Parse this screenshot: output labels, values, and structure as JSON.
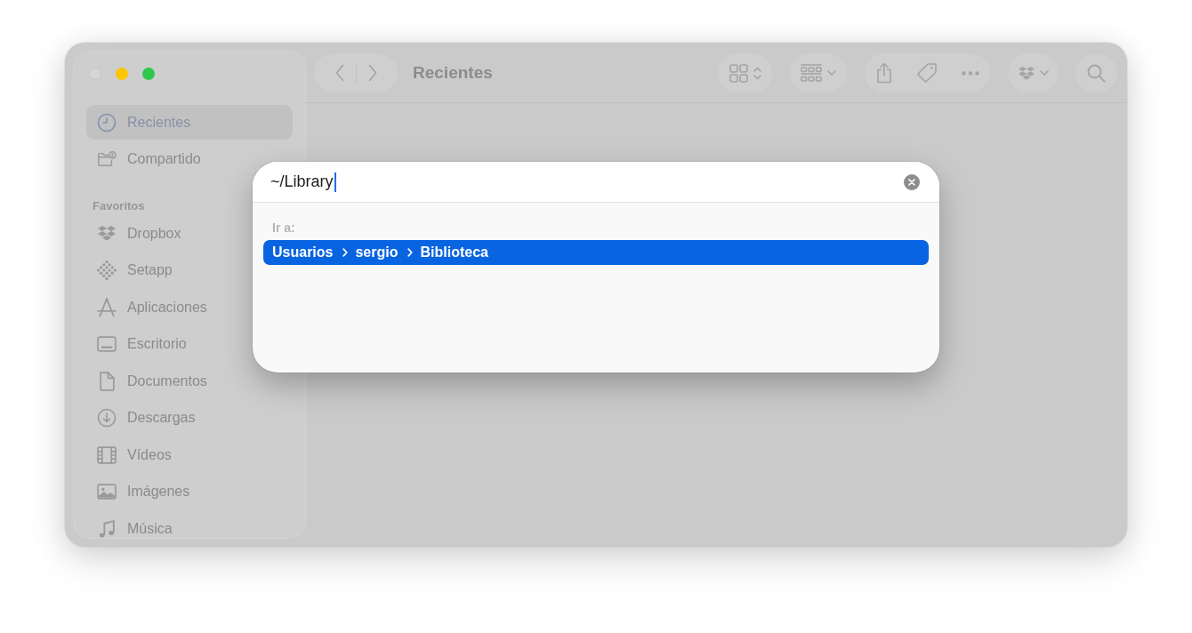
{
  "window": {
    "traffic_lights": [
      {
        "kind": "close",
        "disabled": true
      },
      {
        "kind": "minimize",
        "disabled": false
      },
      {
        "kind": "zoom",
        "disabled": false
      }
    ],
    "title": "Recientes"
  },
  "sidebar": {
    "items": [
      {
        "label": "Recientes",
        "kind": "recents",
        "selected": true
      },
      {
        "label": "Compartido",
        "kind": "shared",
        "selected": false
      }
    ],
    "sections": [
      {
        "title": "Favoritos",
        "items": [
          {
            "label": "Dropbox",
            "kind": "dropbox",
            "selected": false
          },
          {
            "label": "Setapp",
            "kind": "setapp",
            "selected": false
          },
          {
            "label": "Aplicaciones",
            "kind": "applications",
            "selected": false
          },
          {
            "label": "Escritorio",
            "kind": "desktop",
            "selected": false
          },
          {
            "label": "Documentos",
            "kind": "documents",
            "selected": false
          },
          {
            "label": "Descargas",
            "kind": "downloads",
            "selected": false
          },
          {
            "label": "Vídeos",
            "kind": "movies",
            "selected": false
          },
          {
            "label": "Imágenes",
            "kind": "pictures",
            "selected": false
          },
          {
            "label": "Música",
            "kind": "music",
            "selected": false
          }
        ]
      }
    ]
  },
  "go_to_dialog": {
    "path_field": {
      "value": "~/Library",
      "focused": true
    },
    "results_label": "Ir a:",
    "results": [
      {
        "path": [
          "Usuarios",
          "sergio",
          "Biblioteca"
        ],
        "selected": true
      }
    ]
  }
}
